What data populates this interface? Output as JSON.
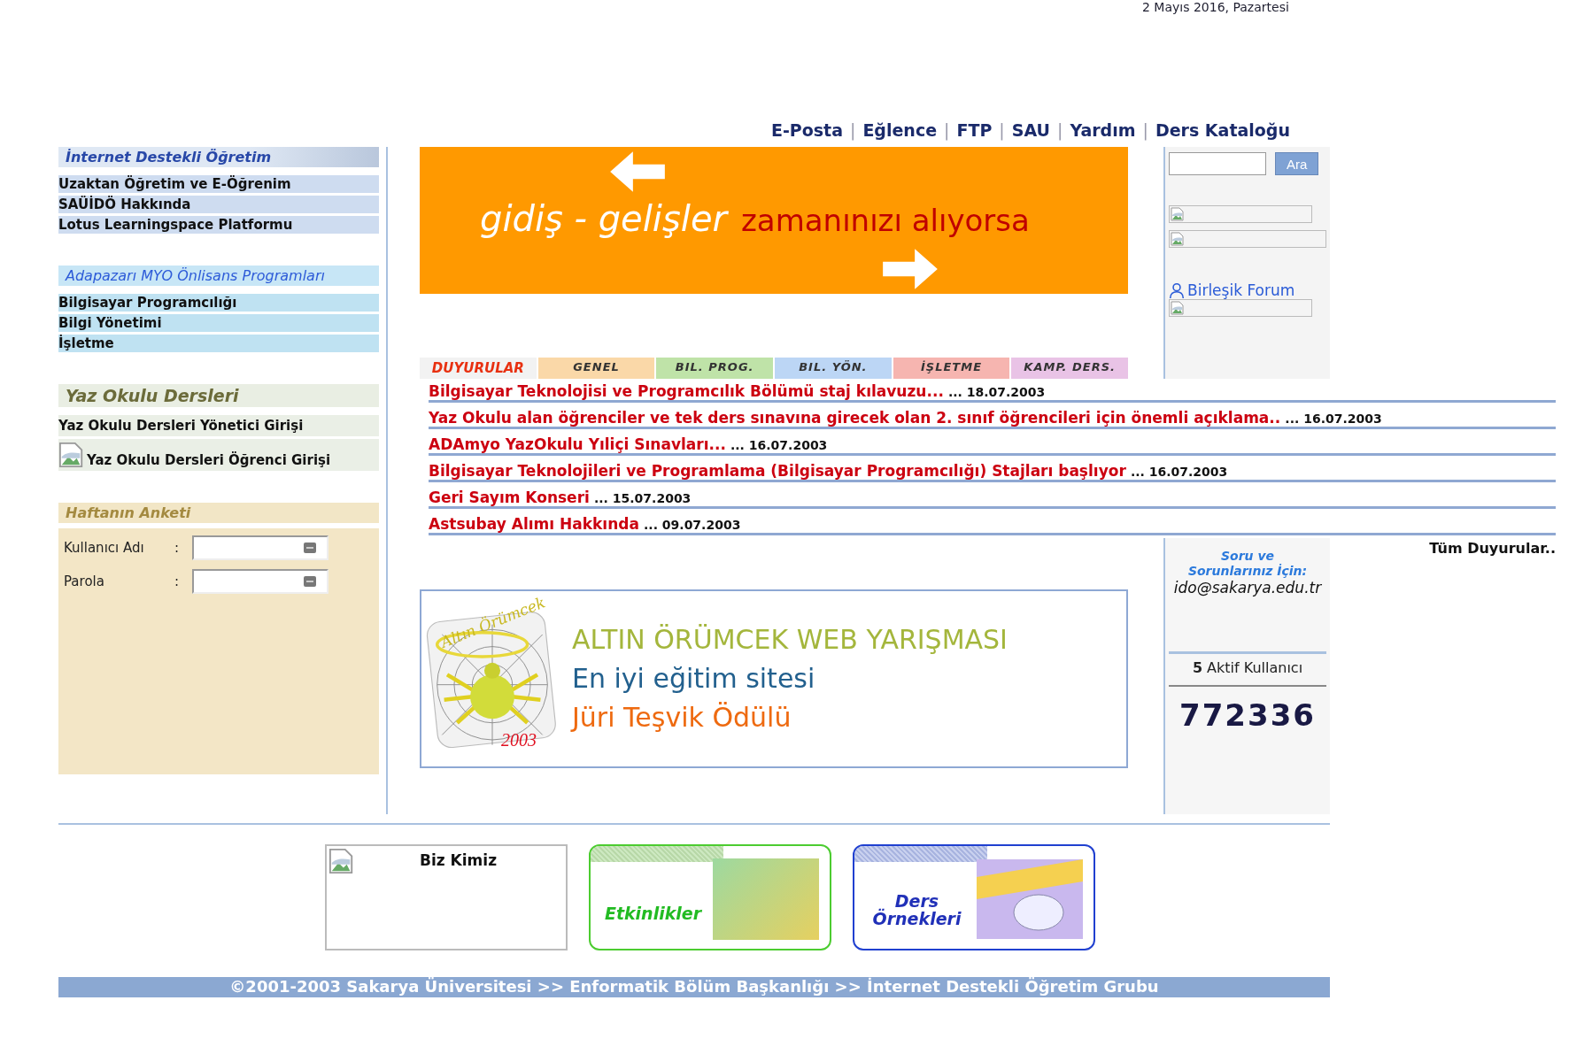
{
  "date": "2 Mayıs 2016, Pazartesi",
  "nav": [
    "E-Posta",
    "Eğlence",
    "FTP",
    "SAU",
    "Yardım",
    "Ders Kataloğu"
  ],
  "nav_separator": "|",
  "sidebar": {
    "sections": [
      {
        "kind": "links",
        "title": "İnternet Destekli Öğretim",
        "items": [
          {
            "label": "Uzaktan Öğretim ve E-Öğrenim"
          },
          {
            "label": "SAÜİDÖ Hakkında"
          },
          {
            "label": "Lotus Learningspace Platformu"
          }
        ]
      },
      {
        "kind": "programs",
        "title": "Adapazarı MYO Önlisans Programları",
        "items": [
          {
            "label": "Bilgisayar Programcılığı"
          },
          {
            "label": "Bilgi Yönetimi"
          },
          {
            "label": "İşletme"
          }
        ]
      },
      {
        "kind": "summer",
        "title": "Yaz Okulu Dersleri",
        "items": [
          {
            "label": "Yaz Okulu Dersleri Yönetici Girişi",
            "broken_image": false
          },
          {
            "label": "Yaz Okulu Dersleri Öğrenci Girişi",
            "broken_image": true
          }
        ]
      }
    ],
    "poll": {
      "title": "Haftanın Anketi",
      "fields": [
        {
          "label": "Kullanıcı Adı",
          "separator": ":"
        },
        {
          "label": "Parola",
          "separator": ":"
        }
      ]
    }
  },
  "banner": {
    "text_1": "gidiş - gelişler",
    "text_2": "zamanınızı alıyorsa"
  },
  "tabs": [
    {
      "label": "DUYURULAR",
      "selected": true,
      "color": "#f2f2f2"
    },
    {
      "label": "GENEL",
      "selected": false,
      "color": "#fad8a8"
    },
    {
      "label": "BIL. PROG.",
      "selected": false,
      "color": "#bfe3a8"
    },
    {
      "label": "BIL. YÖN.",
      "selected": false,
      "color": "#bcd6f5"
    },
    {
      "label": "İŞLETME",
      "selected": false,
      "color": "#f6b5b0"
    },
    {
      "label": "KAMP. DERS.",
      "selected": false,
      "color": "#e9c3e6"
    }
  ],
  "announcements": [
    {
      "title": "Bilgisayar Teknolojisi ve Programcılık Bölümü staj kılavuzu...",
      "date": "... 18.07.2003"
    },
    {
      "title": "Yaz Okulu alan öğrenciler ve tek ders sınavına girecek olan 2. sınıf öğrencileri için önemli açıklama..",
      "date": "... 16.07.2003"
    },
    {
      "title": "ADAmyo YazOkulu Yıliçi Sınavları...",
      "date": "... 16.07.2003"
    },
    {
      "title": "Bilgisayar Teknolojileri ve Programlama (Bilgisayar Programcılığı) Stajları başlıyor",
      "date": "... 16.07.2003"
    },
    {
      "title": "Geri Sayım Konseri",
      "date": "... 15.07.2003"
    },
    {
      "title": "Astsubay Alımı Hakkında",
      "date": "... 09.07.2003"
    }
  ],
  "all_announcements": "Tüm Duyurular..",
  "award": {
    "logo_title": "Altın Örümcek",
    "logo_year": "2003",
    "line_1": "ALTIN ÖRÜMCEK WEB YARIŞMASI",
    "line_2": "En iyi eğitim sitesi",
    "line_3": "Jüri Teşvik Ödülü"
  },
  "right_panel": {
    "search_button": "Ara",
    "forum": "Birleşik Forum",
    "contact_title": "Soru ve Sorunlarınız İçin:",
    "contact_email": "ido@sakarya.edu.tr",
    "active_users": "**5** Aktif Kullanıcı",
    "counter": "772336"
  },
  "cards": [
    {
      "kind": "plain",
      "label": "Biz Kimiz"
    },
    {
      "kind": "photo",
      "label": "Etkinlikler"
    },
    {
      "kind": "drawing",
      "label": "Ders Örnekleri"
    }
  ],
  "footer": "©2001-2003 Sakarya Üniversitesi >> Enformatik Bölüm Başkanlığı >> İnternet Destekli Öğretim Grubu"
}
